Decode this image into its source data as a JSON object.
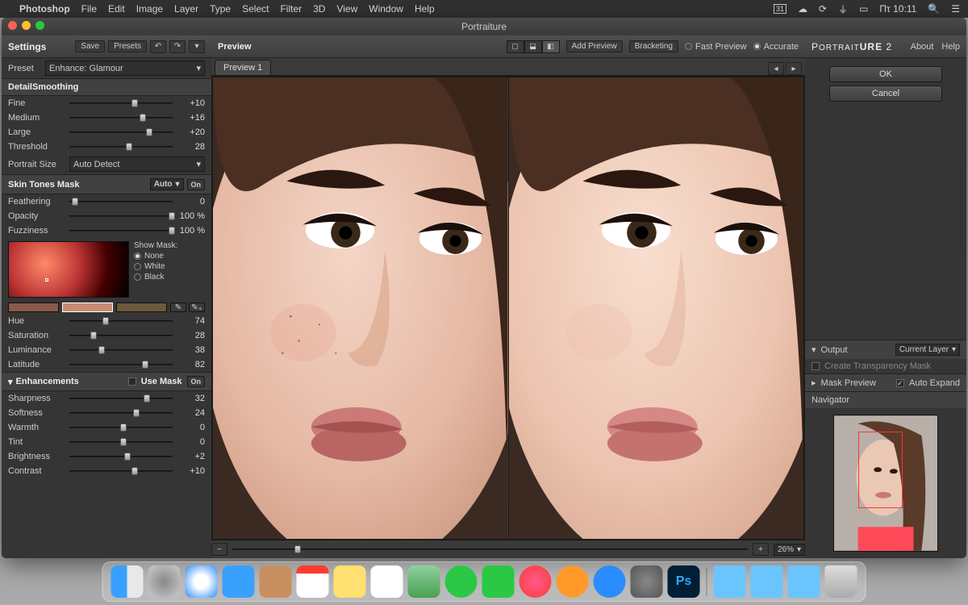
{
  "menubar": {
    "app": "Photoshop",
    "items": [
      "File",
      "Edit",
      "Image",
      "Layer",
      "Type",
      "Select",
      "Filter",
      "3D",
      "View",
      "Window",
      "Help"
    ],
    "clock": "Πτ 10:11",
    "date_icon": "31"
  },
  "window": {
    "title": "Portraiture"
  },
  "settings": {
    "header": "Settings",
    "save": "Save",
    "presets": "Presets",
    "preset_label": "Preset",
    "preset_value": "Enhance: Glamour"
  },
  "detail": {
    "title": "DetailSmoothing",
    "fine": {
      "label": "Fine",
      "value": "+10",
      "pos": 60
    },
    "medium": {
      "label": "Medium",
      "value": "+16",
      "pos": 68
    },
    "large": {
      "label": "Large",
      "value": "+20",
      "pos": 74
    },
    "threshold": {
      "label": "Threshold",
      "value": "28",
      "pos": 55
    },
    "portrait_size_label": "Portrait Size",
    "portrait_size_value": "Auto Detect"
  },
  "skintones": {
    "title": "Skin Tones Mask",
    "mode": "Auto",
    "on": "On",
    "feathering": {
      "label": "Feathering",
      "value": "0",
      "pos": 2
    },
    "opacity": {
      "label": "Opacity",
      "value": "100",
      "unit": "%",
      "pos": 98
    },
    "fuzziness": {
      "label": "Fuzziness",
      "value": "100",
      "unit": "%",
      "pos": 98
    },
    "show_mask_label": "Show Mask:",
    "mask_none": "None",
    "mask_white": "White",
    "mask_black": "Black",
    "hue": {
      "label": "Hue",
      "value": "74",
      "pos": 32
    },
    "saturation": {
      "label": "Saturation",
      "value": "28",
      "pos": 20
    },
    "luminance": {
      "label": "Luminance",
      "value": "38",
      "pos": 28
    },
    "latitude": {
      "label": "Latitude",
      "value": "82",
      "pos": 70
    }
  },
  "enhancements": {
    "title": "Enhancements",
    "use_mask": "Use Mask",
    "on": "On",
    "sharpness": {
      "label": "Sharpness",
      "value": "32",
      "pos": 72
    },
    "softness": {
      "label": "Softness",
      "value": "24",
      "pos": 62
    },
    "warmth": {
      "label": "Warmth",
      "value": "0",
      "pos": 50
    },
    "tint": {
      "label": "Tint",
      "value": "0",
      "pos": 50
    },
    "brightness": {
      "label": "Brightness",
      "value": "+2",
      "pos": 53
    },
    "contrast": {
      "label": "Contrast",
      "value": "+10",
      "pos": 60
    }
  },
  "preview": {
    "title": "Preview",
    "add_preview": "Add Preview",
    "bracketing": "Bracketing",
    "fast": "Fast Preview",
    "accurate": "Accurate",
    "tab": "Preview 1",
    "zoom": "26%"
  },
  "right": {
    "brand": "PORTRAITURE 2",
    "about": "About",
    "help": "Help",
    "ok": "OK",
    "cancel": "Cancel",
    "output": "Output",
    "current_layer": "Current Layer",
    "transparency": "Create Transparency Mask",
    "mask_preview": "Mask Preview",
    "auto_expand": "Auto Expand",
    "navigator": "Navigator"
  }
}
